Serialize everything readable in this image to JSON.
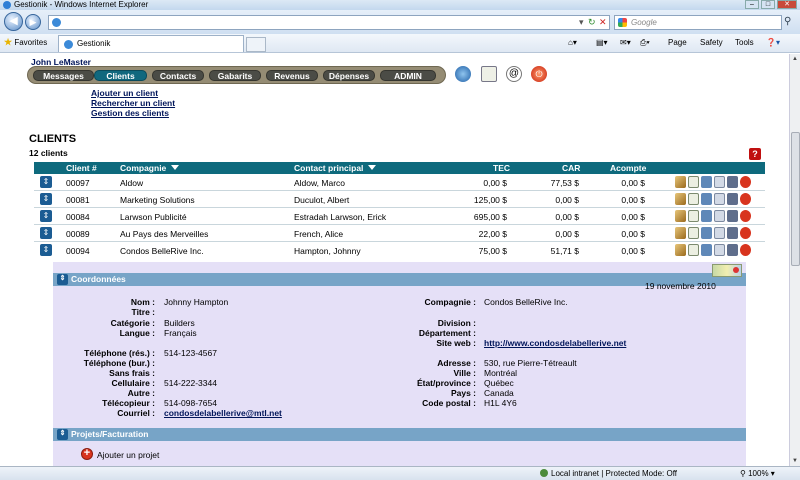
{
  "window": {
    "title": "Gestionik - Windows Internet Explorer"
  },
  "browser": {
    "search_placeholder": "Google",
    "favorites_label": "Favorites",
    "tab_title": "Gestionik",
    "cmd_page": "Page",
    "cmd_safety": "Safety",
    "cmd_tools": "Tools",
    "status_zone": "Local intranet | Protected Mode: Off",
    "zoom": "100%"
  },
  "user": {
    "name": "John LeMaster"
  },
  "menu": [
    "Messages",
    "Clients",
    "Contacts",
    "Gabarits",
    "Revenus",
    "Dépenses",
    "ADMIN"
  ],
  "submenu": [
    "Ajouter un client",
    "Rechercher un client",
    "Gestion des clients"
  ],
  "section": {
    "title": "CLIENTS",
    "count": "12 clients"
  },
  "table": {
    "headers": {
      "client": "Client #",
      "company": "Compagnie",
      "contact": "Contact principal",
      "tec": "TEC",
      "car": "CAR",
      "acompte": "Acompte"
    },
    "rows": [
      {
        "client": "00097",
        "company": "Aldow",
        "contact": "Aldow, Marco",
        "tec": "0,00 $",
        "car": "77,53 $",
        "acompte": "0,00 $"
      },
      {
        "client": "00081",
        "company": "Marketing Solutions",
        "contact": "Duculot, Albert",
        "tec": "125,00 $",
        "car": "0,00 $",
        "acompte": "0,00 $"
      },
      {
        "client": "00084",
        "company": "Larwson Publicité",
        "contact": "Estradah Larwson, Erick",
        "tec": "695,00 $",
        "car": "0,00 $",
        "acompte": "0,00 $"
      },
      {
        "client": "00089",
        "company": "Au Pays des Merveilles",
        "contact": "French, Alice",
        "tec": "22,00 $",
        "car": "0,00 $",
        "acompte": "0,00 $"
      },
      {
        "client": "00094",
        "company": "Condos BelleRive Inc.",
        "contact": "Hampton, Johnny",
        "tec": "75,00 $",
        "car": "51,71 $",
        "acompte": "0,00 $"
      }
    ]
  },
  "detail": {
    "coord_title": "Coordonnées",
    "date": "19 novembre 2010",
    "left": [
      {
        "label": "Nom :",
        "value": "Johnny Hampton"
      },
      {
        "label": "Titre :",
        "value": ""
      },
      {
        "label": "Catégorie :",
        "value": "Builders"
      },
      {
        "label": "Langue :",
        "value": "Français"
      },
      {
        "label": "Téléphone (rés.) :",
        "value": "514-123-4567"
      },
      {
        "label": "Téléphone (bur.) :",
        "value": ""
      },
      {
        "label": "Sans frais :",
        "value": ""
      },
      {
        "label": "Cellulaire :",
        "value": "514-222-3344"
      },
      {
        "label": "Autre :",
        "value": ""
      },
      {
        "label": "Télécopieur :",
        "value": "514-098-7654"
      },
      {
        "label": "Courriel :",
        "value": "condosdelabellerive@mtl.net"
      }
    ],
    "right": [
      {
        "label": "Compagnie :",
        "value": "Condos BelleRive Inc."
      },
      {
        "label": "Division :",
        "value": ""
      },
      {
        "label": "Département :",
        "value": ""
      },
      {
        "label": "Site web :",
        "value": "http://www.condosdelabellerive.net"
      },
      {
        "label": "Adresse :",
        "value": "530, rue Pierre-Tétreault"
      },
      {
        "label": "Ville :",
        "value": "Montréal"
      },
      {
        "label": "État/province :",
        "value": "Québec"
      },
      {
        "label": "Pays :",
        "value": "Canada"
      },
      {
        "label": "Code postal :",
        "value": "H1L 4Y6"
      }
    ],
    "proj_title": "Projets/Facturation",
    "add_project": "Ajouter un projet"
  }
}
